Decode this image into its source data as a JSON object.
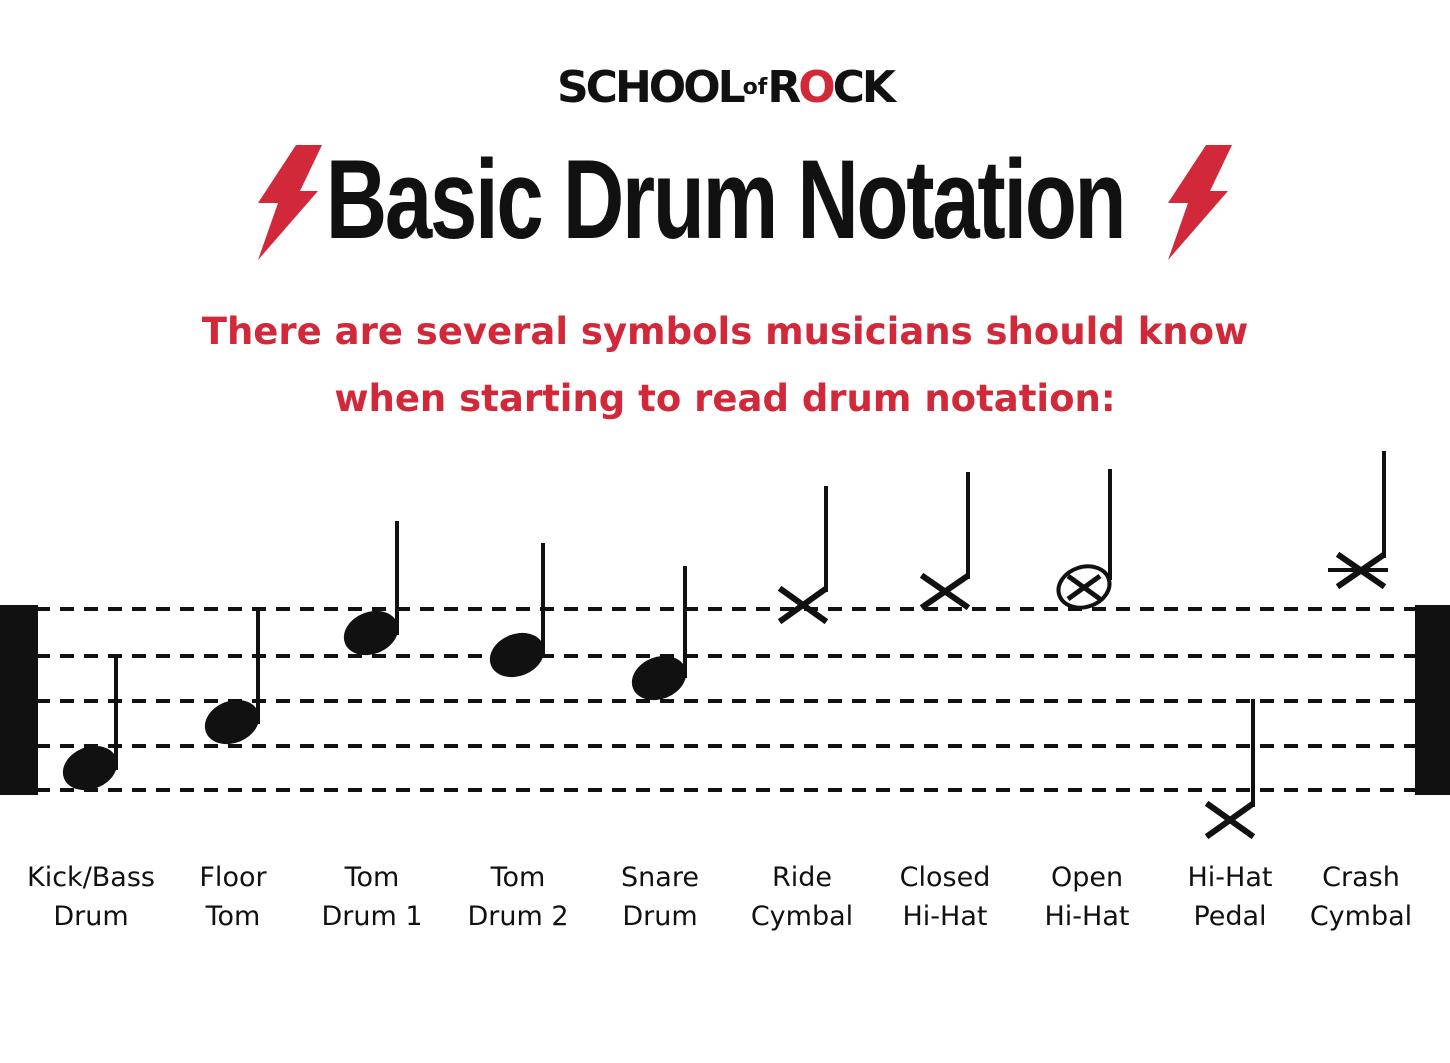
{
  "logo": {
    "school": "SCHOOL",
    "of": "of",
    "rock_r": "R",
    "rock_o": "O",
    "rock_ck": "CK"
  },
  "title": "Basic Drum Notation",
  "subtitle": "There are several symbols musicians should know when starting to read drum notation:",
  "colors": {
    "accent": "#d1283a",
    "ink": "#111111"
  },
  "symbols": [
    {
      "line1": "Kick/Bass",
      "line2": "Drum",
      "head": "filled"
    },
    {
      "line1": "Floor",
      "line2": "Tom",
      "head": "filled"
    },
    {
      "line1": "Tom",
      "line2": "Drum 1",
      "head": "filled"
    },
    {
      "line1": "Tom",
      "line2": "Drum 2",
      "head": "filled"
    },
    {
      "line1": "Snare",
      "line2": "Drum",
      "head": "filled"
    },
    {
      "line1": "Ride",
      "line2": "Cymbal",
      "head": "x"
    },
    {
      "line1": "Closed",
      "line2": "Hi-Hat",
      "head": "x"
    },
    {
      "line1": "Open",
      "line2": "Hi-Hat",
      "head": "circle-x"
    },
    {
      "line1": "Hi-Hat",
      "line2": "Pedal",
      "head": "x"
    },
    {
      "line1": "Crash",
      "line2": "Cymbal",
      "head": "x-ledger"
    }
  ]
}
